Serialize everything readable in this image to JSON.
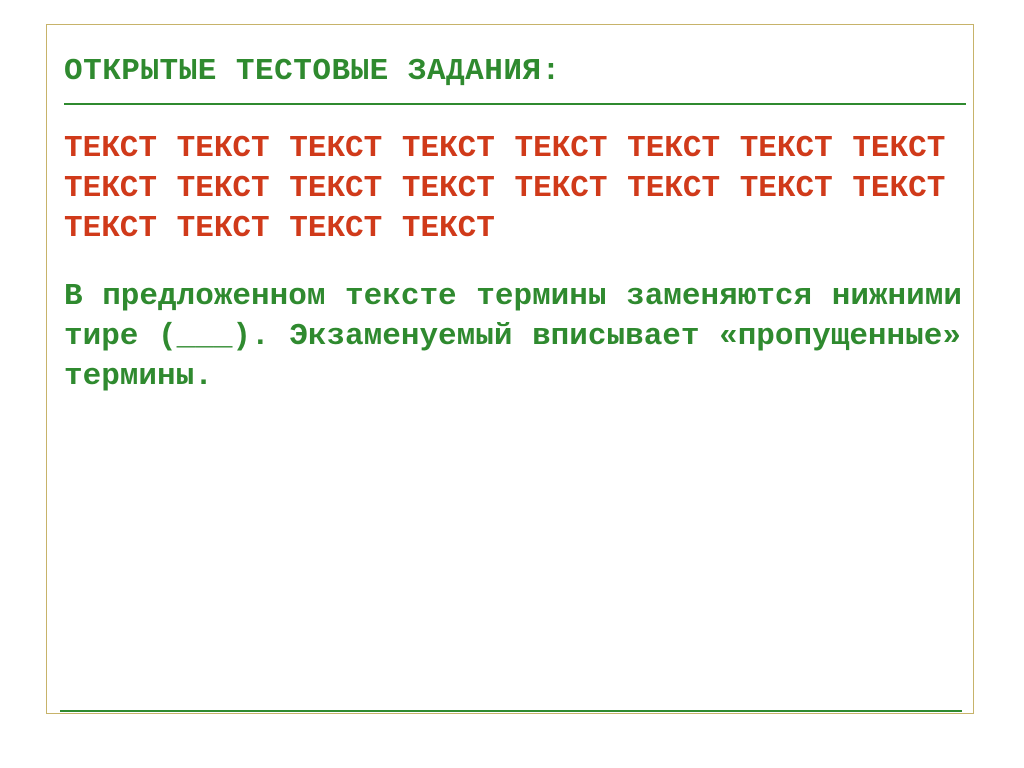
{
  "heading": "ОТКРЫТЫЕ ТЕСТОВЫЕ ЗАДАНИЯ:",
  "body": {
    "sample_text": "ТЕКСТ ТЕКСТ ТЕКСТ ТЕКСТ ТЕКСТ ТЕКСТ ТЕКСТ ТЕКСТ ТЕКСТ ТЕКСТ ТЕКСТ ТЕКСТ ТЕКСТ ТЕКСТ ТЕКСТ ТЕКСТ ТЕКСТ ТЕКСТ ТЕКСТ ТЕКСТ",
    "instruction": "В предложенном тексте термины заменяются нижними тире (___). Экзаменуемый вписывает «пропущенные» термины."
  },
  "colors": {
    "green": "#2f8a2f",
    "red": "#d03a1a",
    "frame": "#c7b36a"
  }
}
